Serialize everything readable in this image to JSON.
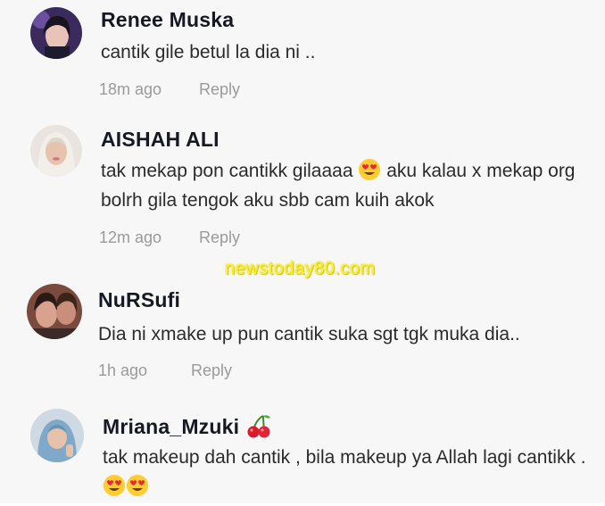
{
  "comments": [
    {
      "username": "Renee Muska",
      "text": "cantik gile betul la dia ni ..",
      "time": "18m ago",
      "reply_label": "Reply"
    },
    {
      "username": "AISHAH ALI",
      "text_part1": "tak mekap pon cantikk gilaaaa",
      "text_part2": "aku kalau x mekap org bolrh gila tengok aku sbb cam kuih akok",
      "time": "12m ago",
      "reply_label": "Reply"
    },
    {
      "username": "NuRSufi",
      "text": "Dia ni xmake up pun cantik suka sgt tgk muka dia..",
      "time": "1h ago",
      "reply_label": "Reply"
    },
    {
      "username": "Mriana_Mzuki",
      "text": "tak makeup dah cantik , bila makeup ya Allah lagi cantikk ."
    }
  ],
  "watermark": "newstoday80.com",
  "icons": {
    "heart_eyes": "heart-eyes-emoji",
    "cherries": "cherries-emoji"
  },
  "colors": {
    "background": "#f7f7f7",
    "username": "#161823",
    "meta": "#9a9a9a",
    "watermark": "#fff200"
  }
}
